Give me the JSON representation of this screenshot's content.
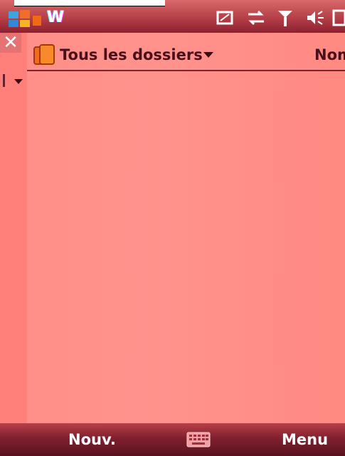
{
  "status_bar": {
    "title": "W",
    "icons": [
      "start-logo",
      "notification-icon",
      "sync-icon",
      "signal-icon",
      "volume-icon",
      "battery-icon"
    ]
  },
  "side_panel": {
    "close_symbol": "✕"
  },
  "main": {
    "folder_label": "Tous les dossiers",
    "sort_label": "Nom",
    "messages": []
  },
  "softkeys": {
    "left": "Nouv.",
    "right": "Menu"
  },
  "colors": {
    "background": "#ff8c84",
    "bar_dark": "#80202e",
    "text_dark": "#4a0f1a",
    "accent_orange": "#f26a1b"
  }
}
